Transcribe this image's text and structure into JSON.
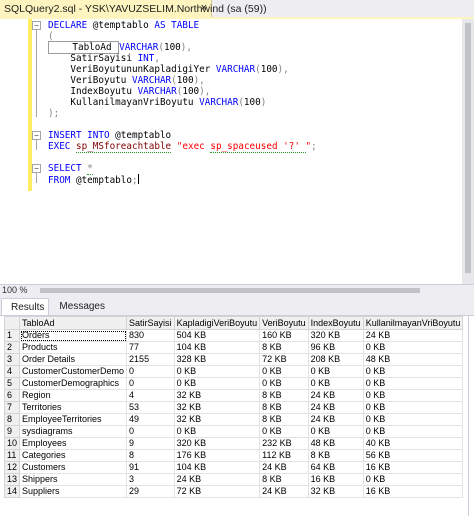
{
  "tab": {
    "title": "SQLQuery2.sql - YSK\\YAVUZSELIM.Northwind (sa (59))",
    "close_glyph": "×"
  },
  "editor": {
    "zoom": "100 %",
    "lines": [
      [
        {
          "t": "DECLARE",
          "c": "kw"
        },
        {
          "t": " @temptablo ",
          "c": "id"
        },
        {
          "t": "AS",
          "c": "kw"
        },
        {
          "t": " ",
          "c": "id"
        },
        {
          "t": "TABLE",
          "c": "kw"
        }
      ],
      [
        {
          "t": "(",
          "c": "sy"
        }
      ],
      [
        {
          "t": "    TabloAd ",
          "c": "id",
          "box": true
        },
        {
          "t": "VARCHAR",
          "c": "kw"
        },
        {
          "t": "(",
          "c": "sy"
        },
        {
          "t": "100",
          "c": "id"
        },
        {
          "t": "),",
          "c": "sy"
        }
      ],
      [
        {
          "t": "    SatirSayisi ",
          "c": "id"
        },
        {
          "t": "INT",
          "c": "kw"
        },
        {
          "t": ",",
          "c": "sy"
        }
      ],
      [
        {
          "t": "    VeriBoyutununKapladigiYer ",
          "c": "id"
        },
        {
          "t": "VARCHAR",
          "c": "kw"
        },
        {
          "t": "(",
          "c": "sy"
        },
        {
          "t": "100",
          "c": "id"
        },
        {
          "t": "),",
          "c": "sy"
        }
      ],
      [
        {
          "t": "    VeriBoyutu ",
          "c": "id"
        },
        {
          "t": "VARCHAR",
          "c": "kw"
        },
        {
          "t": "(",
          "c": "sy"
        },
        {
          "t": "100",
          "c": "id"
        },
        {
          "t": "),",
          "c": "sy"
        }
      ],
      [
        {
          "t": "    IndexBoyutu ",
          "c": "id"
        },
        {
          "t": "VARCHAR",
          "c": "kw"
        },
        {
          "t": "(",
          "c": "sy"
        },
        {
          "t": "100",
          "c": "id"
        },
        {
          "t": "),",
          "c": "sy"
        }
      ],
      [
        {
          "t": "    KullanilmayanVriBoyutu ",
          "c": "id"
        },
        {
          "t": "VARCHAR",
          "c": "kw"
        },
        {
          "t": "(",
          "c": "sy"
        },
        {
          "t": "100",
          "c": "id"
        },
        {
          "t": ")",
          "c": "sy"
        }
      ],
      [
        {
          "t": ");",
          "c": "sy"
        }
      ],
      [],
      [
        {
          "t": "INSERT INTO",
          "c": "kw"
        },
        {
          "t": " @temptablo",
          "c": "id"
        }
      ],
      [
        {
          "t": "EXEC",
          "c": "kw"
        },
        {
          "t": " ",
          "c": "id"
        },
        {
          "t": "sp_MSforeachtable",
          "c": "fn",
          "sq": true
        },
        {
          "t": " ",
          "c": "id"
        },
        {
          "t": "\"",
          "c": "st"
        },
        {
          "t": "exec ",
          "c": "st"
        },
        {
          "t": "sp_spaceused '?' ",
          "c": "st",
          "sq": true
        },
        {
          "t": "\"",
          "c": "st"
        },
        {
          "t": ";",
          "c": "sy"
        }
      ],
      [],
      [
        {
          "t": "SELECT",
          "c": "kw"
        },
        {
          "t": " ",
          "c": "id"
        },
        {
          "t": "*",
          "c": "sy",
          "sq": true
        }
      ],
      [
        {
          "t": "FROM",
          "c": "kw"
        },
        {
          "t": " @temptablo",
          "c": "id"
        },
        {
          "t": ";",
          "c": "sy"
        },
        {
          "t": "",
          "c": "cursor"
        }
      ]
    ]
  },
  "results": {
    "tab_results": "Results",
    "tab_messages": "Messages",
    "columns": [
      "TabloAd",
      "SatirSayisi",
      "KapladigiVeriBoyutu",
      "VeriBoyutu",
      "IndexBoyutu",
      "KullanilmayanVriBoyutu"
    ],
    "rows": [
      [
        "1",
        "Orders",
        "830",
        "504 KB",
        "160 KB",
        "320 KB",
        "24 KB"
      ],
      [
        "2",
        "Products",
        "77",
        "104 KB",
        "8 KB",
        "96 KB",
        "0 KB"
      ],
      [
        "3",
        "Order Details",
        "2155",
        "328 KB",
        "72 KB",
        "208 KB",
        "48 KB"
      ],
      [
        "4",
        "CustomerCustomerDemo",
        "0",
        "0 KB",
        "0 KB",
        "0 KB",
        "0 KB"
      ],
      [
        "5",
        "CustomerDemographics",
        "0",
        "0 KB",
        "0 KB",
        "0 KB",
        "0 KB"
      ],
      [
        "6",
        "Region",
        "4",
        "32 KB",
        "8 KB",
        "24 KB",
        "0 KB"
      ],
      [
        "7",
        "Territories",
        "53",
        "32 KB",
        "8 KB",
        "24 KB",
        "0 KB"
      ],
      [
        "8",
        "EmployeeTerritories",
        "49",
        "32 KB",
        "8 KB",
        "24 KB",
        "0 KB"
      ],
      [
        "9",
        "sysdiagrams",
        "0",
        "0 KB",
        "0 KB",
        "0 KB",
        "0 KB"
      ],
      [
        "10",
        "Employees",
        "9",
        "320 KB",
        "232 KB",
        "48 KB",
        "40 KB"
      ],
      [
        "11",
        "Categories",
        "8",
        "176 KB",
        "112 KB",
        "8 KB",
        "56 KB"
      ],
      [
        "12",
        "Customers",
        "91",
        "104 KB",
        "24 KB",
        "64 KB",
        "16 KB"
      ],
      [
        "13",
        "Shippers",
        "3",
        "24 KB",
        "8 KB",
        "16 KB",
        "0 KB"
      ],
      [
        "14",
        "Suppliers",
        "29",
        "72 KB",
        "24 KB",
        "32 KB",
        "16 KB"
      ]
    ]
  }
}
